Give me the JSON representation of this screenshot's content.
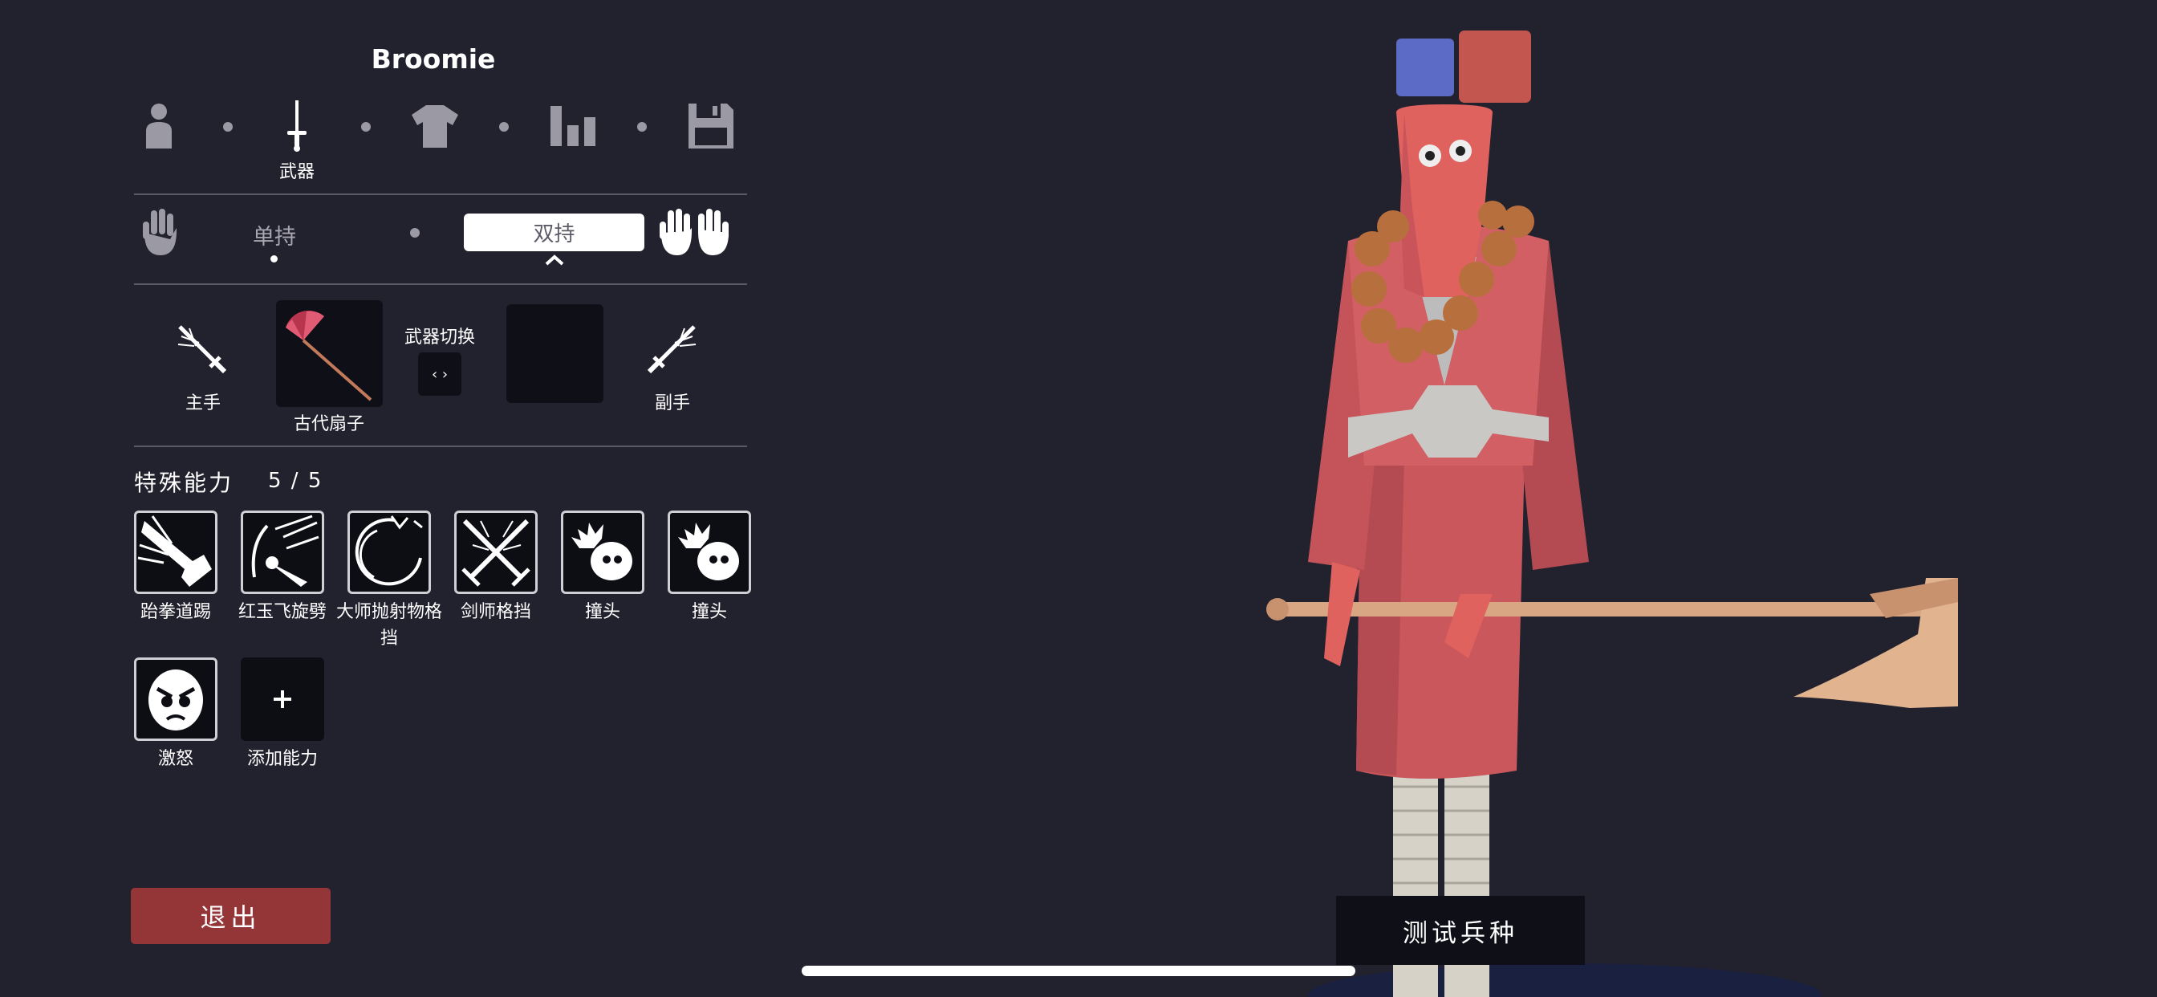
{
  "unit": {
    "name": "Broomie"
  },
  "steps": [
    {
      "icon": "person-icon"
    },
    {
      "icon": "sword-icon",
      "label": "武器",
      "active": true
    },
    {
      "icon": "shirt-icon"
    },
    {
      "icon": "stats-icon"
    },
    {
      "icon": "save-icon"
    }
  ],
  "grip": {
    "single_label": "单持",
    "dual_label": "双持",
    "selected": "dual"
  },
  "weapons": {
    "main_hand_label": "主手",
    "main_weapon_name": "古代扇子",
    "switch_label": "武器切换",
    "switch_glyph": "‹ ›",
    "off_hand_label": "副手"
  },
  "abilities": {
    "heading": "特殊能力",
    "count": "5 / 5",
    "items": [
      {
        "label": "跆拳道踢",
        "icon": "kick-icon"
      },
      {
        "label": "红玉飞旋劈",
        "icon": "spin-slash-icon"
      },
      {
        "label": "大师抛射物格挡",
        "icon": "projectile-block-icon"
      },
      {
        "label": "剑师格挡",
        "icon": "crossed-swords-icon"
      },
      {
        "label": "撞头",
        "icon": "headbutt-icon"
      },
      {
        "label": "撞头",
        "icon": "headbutt-icon"
      },
      {
        "label": "激怒",
        "icon": "angry-face-icon"
      },
      {
        "label": "添加能力",
        "icon": "plus-icon"
      }
    ]
  },
  "buttons": {
    "exit": "退出",
    "test_unit": "测试兵种"
  },
  "colors": {
    "background": "#22212e",
    "exit_button": "#943538",
    "team_blue": "#5c6bc6",
    "team_red": "#c45650",
    "unit_body": "#d9615f"
  }
}
